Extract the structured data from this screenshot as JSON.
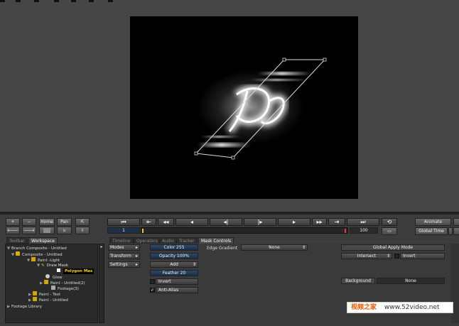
{
  "toolbar": {
    "plus": "+",
    "minus": "−",
    "home": "Home",
    "pan": "Pan"
  },
  "transport": {
    "frame_current": "1",
    "frame_end": "100",
    "animate": "Animate",
    "global_time": "Global Time"
  },
  "left_tabs": [
    "Toolbar",
    "Workspace"
  ],
  "right_tabs": [
    "Timeline",
    "Operators",
    "Audio",
    "Tracker",
    "Mask Controls"
  ],
  "tree": [
    {
      "label": "Branch  Composite - Untitled",
      "selected": false
    },
    {
      "label": "Composite - Untitled",
      "selected": false
    },
    {
      "label": "Paint -Light",
      "selected": false
    },
    {
      "label": "Draw Mask",
      "selected": false
    },
    {
      "label": "Polygon Mas",
      "selected": true
    },
    {
      "label": "Glow",
      "selected": false
    },
    {
      "label": "Paint - Untitled(2)",
      "selected": false
    },
    {
      "label": "Footage(3)",
      "selected": false
    },
    {
      "label": "Paint - Text",
      "selected": false
    },
    {
      "label": "Paint - Untitled",
      "selected": false
    },
    {
      "label": "Footage Library",
      "selected": false
    }
  ],
  "mask_controls": {
    "side_buttons": [
      "Modes",
      "Transform",
      "Settings"
    ],
    "color": "Color 255",
    "opacity": "Opacity 100%",
    "mode": "Add",
    "feather": "Feather 20",
    "invert": "Invert",
    "anti_alias": "Anti-Alias",
    "edge_gradient_label": "Edge Gradient",
    "edge_gradient_value": "None",
    "global_apply_mode": "Global Apply Mode",
    "intersect": "Intersect",
    "invert2": "Invert",
    "background_label": "Background",
    "background_value": "None"
  },
  "watermark": {
    "cn": "视频之家",
    "url": "www.52video.net"
  }
}
